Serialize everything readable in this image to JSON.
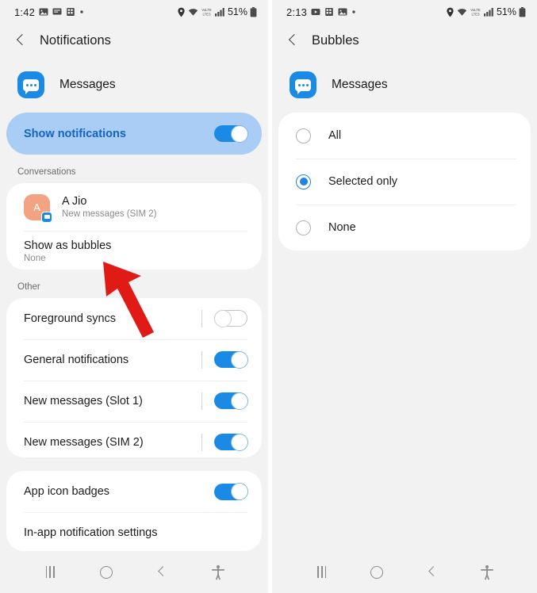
{
  "left_phone": {
    "status_bar": {
      "time": "1:42",
      "left_icons": [
        "image-icon",
        "message-icon",
        "apps-icon",
        "dot-icon"
      ],
      "right_icons": [
        "location-icon",
        "wifi-icon",
        "volte-icon",
        "signal-icon"
      ],
      "battery": "51%"
    },
    "app_bar": {
      "back": "back-arrow",
      "title": "Notifications"
    },
    "app_header": {
      "icon": "messages-app-icon",
      "name": "Messages"
    },
    "show_notifications": {
      "label": "Show notifications",
      "toggle": "on"
    },
    "conversations": {
      "section_label": "Conversations",
      "contact": {
        "avatar_letter": "A",
        "name": "A Jio",
        "subtitle": "New messages (SIM 2)"
      },
      "bubbles": {
        "title": "Show as bubbles",
        "value": "None"
      }
    },
    "other": {
      "section_label": "Other",
      "items": [
        {
          "label": "Foreground syncs",
          "toggle": "off",
          "divider": true
        },
        {
          "label": "General notifications",
          "toggle": "on",
          "divider": true
        },
        {
          "label": "New messages (Slot 1)",
          "toggle": "on",
          "divider": true
        },
        {
          "label": "New messages (SIM 2)",
          "toggle": "on",
          "divider": true
        }
      ]
    },
    "bottom_card": {
      "items": [
        {
          "label": "App icon badges",
          "toggle": "on",
          "divider": false
        },
        {
          "label": "In-app notification settings",
          "toggle": null,
          "divider": false
        }
      ]
    },
    "nav_bar": [
      "recents-button",
      "home-button",
      "back-button",
      "accessibility-button"
    ]
  },
  "right_phone": {
    "status_bar": {
      "time": "2:13",
      "left_icons": [
        "video-icon",
        "apps-icon",
        "image-icon",
        "dot-icon"
      ],
      "right_icons": [
        "location-icon",
        "wifi-icon",
        "volte-icon",
        "signal-icon"
      ],
      "battery": "51%"
    },
    "app_bar": {
      "back": "back-arrow",
      "title": "Bubbles"
    },
    "app_header": {
      "icon": "messages-app-icon",
      "name": "Messages"
    },
    "options": [
      {
        "label": "All",
        "selected": false
      },
      {
        "label": "Selected only",
        "selected": true
      },
      {
        "label": "None",
        "selected": false
      }
    ],
    "nav_bar": [
      "recents-button",
      "home-button",
      "back-button",
      "accessibility-button"
    ]
  },
  "annotation": {
    "arrow_color": "#e01b16",
    "points_to": "Show as bubbles"
  },
  "colors": {
    "accent_blue": "#1a8ae5",
    "highlight_bg": "#a9cdf5",
    "highlight_text": "#1364c4",
    "page_bg": "#f2f2f2",
    "card_bg": "#ffffff",
    "avatar_bg": "#f2a383"
  }
}
